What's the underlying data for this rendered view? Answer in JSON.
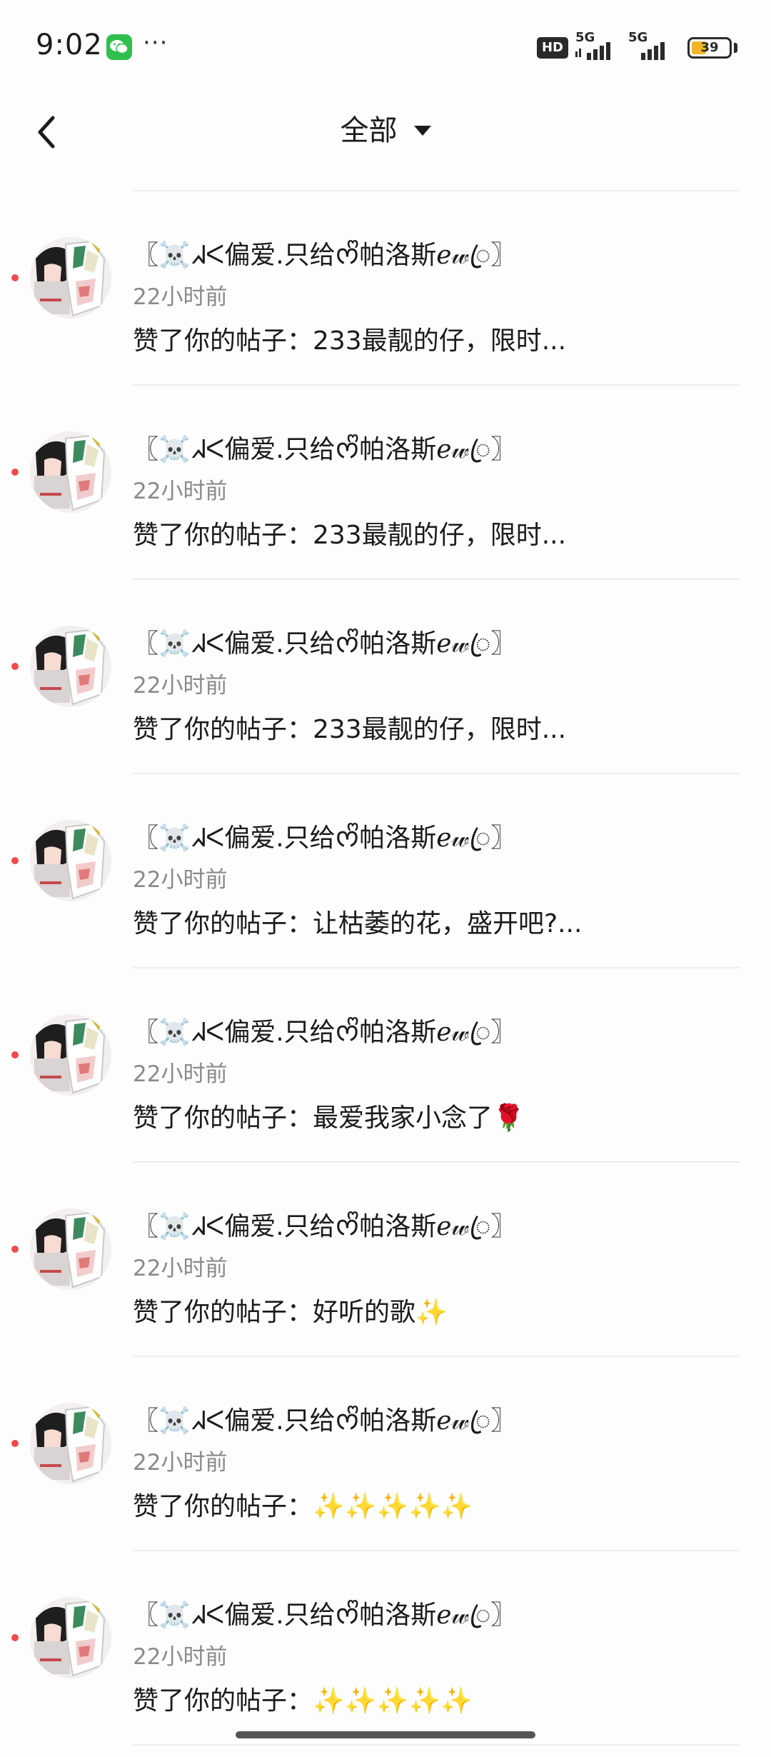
{
  "status_bar": {
    "time": "9:02",
    "app_icon": "wechat-icon",
    "more": "···",
    "hd_badge": "HD",
    "network_1": "5G",
    "network_2": "5G",
    "battery_percent": "39",
    "battery_level": 0.39
  },
  "header": {
    "back_icon": "chevron-left-icon",
    "title": "全部",
    "dropdown_icon": "caret-down-icon"
  },
  "notifications": [
    {
      "name": "〖☠️ᖽᐸ偏爱.只给ᰔᩚ帕洛斯ℯ𝓌ꦿ〗",
      "time": "22小时前",
      "text": "赞了你的帖子：233最靓的仔，限时...",
      "unread": true
    },
    {
      "name": "〖☠️ᖽᐸ偏爱.只给ᰔᩚ帕洛斯ℯ𝓌ꦿ〗",
      "time": "22小时前",
      "text": "赞了你的帖子：233最靓的仔，限时...",
      "unread": true
    },
    {
      "name": "〖☠️ᖽᐸ偏爱.只给ᰔᩚ帕洛斯ℯ𝓌ꦿ〗",
      "time": "22小时前",
      "text": "赞了你的帖子：233最靓的仔，限时...",
      "unread": true
    },
    {
      "name": "〖☠️ᖽᐸ偏爱.只给ᰔᩚ帕洛斯ℯ𝓌ꦿ〗",
      "time": "22小时前",
      "text": "赞了你的帖子：让枯萎的花，盛开吧?...",
      "unread": true
    },
    {
      "name": "〖☠️ᖽᐸ偏爱.只给ᰔᩚ帕洛斯ℯ𝓌ꦿ〗",
      "time": "22小时前",
      "text": "赞了你的帖子：最爱我家小念了🌹",
      "unread": true
    },
    {
      "name": "〖☠️ᖽᐸ偏爱.只给ᰔᩚ帕洛斯ℯ𝓌ꦿ〗",
      "time": "22小时前",
      "text": "赞了你的帖子：好听的歌✨",
      "unread": true
    },
    {
      "name": "〖☠️ᖽᐸ偏爱.只给ᰔᩚ帕洛斯ℯ𝓌ꦿ〗",
      "time": "22小时前",
      "text": "赞了你的帖子：✨✨✨✨✨",
      "unread": true
    },
    {
      "name": "〖☠️ᖽᐸ偏爱.只给ᰔᩚ帕洛斯ℯ𝓌ꦿ〗",
      "time": "22小时前",
      "text": "赞了你的帖子：✨✨✨✨✨",
      "unread": true
    }
  ]
}
